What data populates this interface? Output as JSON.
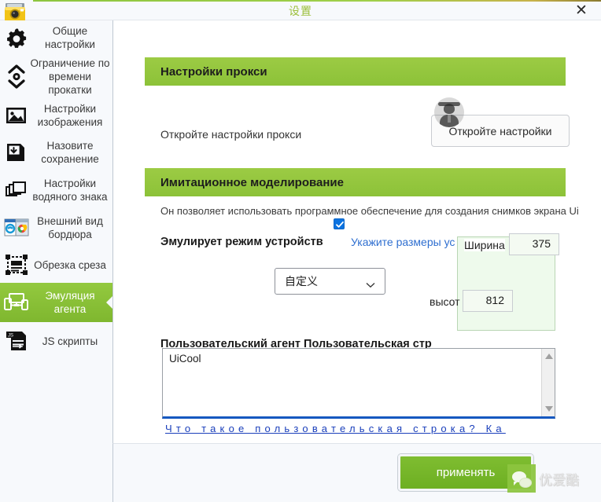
{
  "window": {
    "title": "设置",
    "app_icon": "camera-icon",
    "close_label": "✕",
    "accent_color": "#8dc63f",
    "title_color": "#9cbf3b"
  },
  "sidebar": {
    "items": [
      {
        "label": "Общие настройки",
        "icon": "gear-icon",
        "selected": false,
        "name": "general-settings"
      },
      {
        "label": "Ограничение по времени прокатки",
        "icon": "spinner-updown-icon",
        "selected": false,
        "name": "time-limit"
      },
      {
        "label": "Настройки изображения",
        "icon": "image-icon",
        "selected": false,
        "name": "image-settings"
      },
      {
        "label": "Назовите сохранение",
        "icon": "save-as-icon",
        "selected": false,
        "name": "save-naming"
      },
      {
        "label": "Настройки водяного знака",
        "icon": "windows-stack-icon",
        "selected": false,
        "name": "watermark-settings"
      },
      {
        "label": "Внешний вид бордюра",
        "icon": "browsers-icon",
        "selected": false,
        "name": "border-appearance"
      },
      {
        "label": "Обрезка среза",
        "icon": "crop-icon",
        "selected": false,
        "name": "crop-slice"
      },
      {
        "label": "Эмуляция агента",
        "icon": "devices-icon",
        "selected": true,
        "name": "agent-emulation"
      },
      {
        "label": "JS скрипты",
        "icon": "js-script-icon",
        "selected": false,
        "name": "js-scripts"
      }
    ]
  },
  "main": {
    "proxy_section": {
      "header": "Настройки прокси",
      "row_label": "Откройте настройки прокси",
      "button_label": "Откройте настройки",
      "cursor_icon": "user-avatar-cursor-icon"
    },
    "emulation_section": {
      "header": "Имитационное моделирование",
      "description": "Он позволяет использовать программное обеспечение для создания снимков экрана Ui",
      "device_mode_label": "Эмулирует режим устройств",
      "checkbox_checked": true,
      "checkbox_icon": "checkmark-icon",
      "size_link": "Укажите размеры ус",
      "device_select_value": "自定义",
      "select_caret_icon": "chevron-down-icon",
      "width_label": "Ширина",
      "width_value": "375",
      "height_label": "высот",
      "height_value": "812",
      "preview_fill": "#eefaec"
    },
    "user_agent_section": {
      "label": "Пользовательский агент Пользовательская стр",
      "textarea_value": "UiCool",
      "scrollbar_up_icon": "arrow-up-icon",
      "scrollbar_down_icon": "arrow-down-icon",
      "help_link": "Что такое пользовательская строка? Ка"
    }
  },
  "footer": {
    "apply_label": "применять"
  },
  "watermark": {
    "logo_icon": "wechat-icon",
    "text": "优爱酷"
  }
}
